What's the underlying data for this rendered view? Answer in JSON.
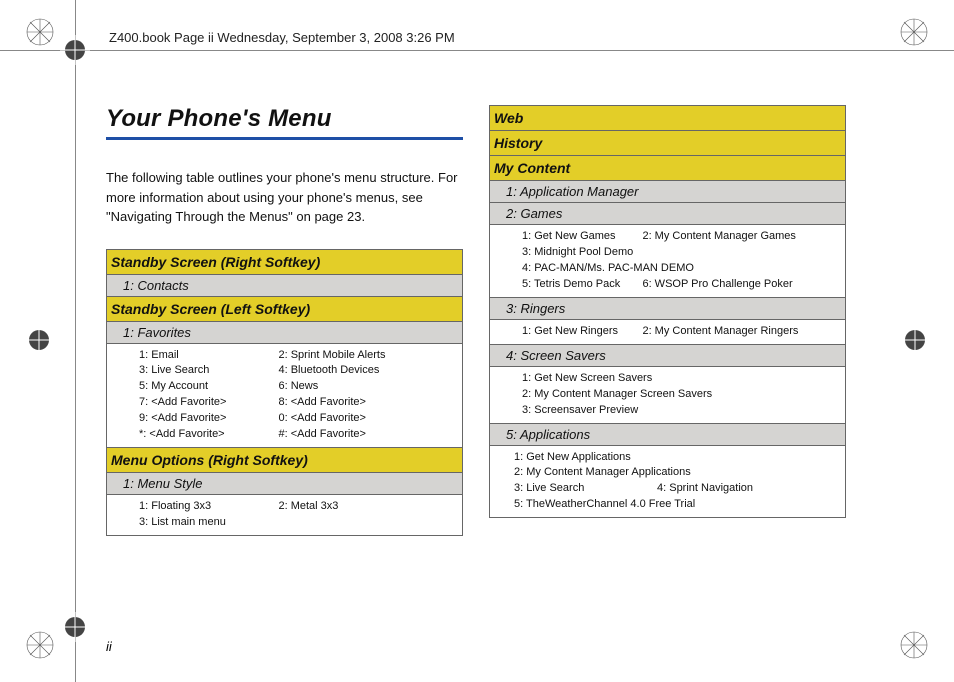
{
  "header": "Z400.book  Page ii  Wednesday, September 3, 2008  3:26 PM",
  "title": "Your Phone's Menu",
  "intro": "The following table outlines your phone's menu structure. For more information about using your phone's menus, see \"Navigating Through the Menus\" on page 23.",
  "page_number": "ii",
  "left_table": {
    "h1": "Standby Screen (Right Softkey)",
    "s1": "1: Contacts",
    "h2": "Standby Screen (Left Softkey)",
    "s2": "1: Favorites",
    "fav_l1": "1: Email",
    "fav_r1": "2: Sprint Mobile Alerts",
    "fav_l2": "3: Live Search",
    "fav_r2": "4: Bluetooth Devices",
    "fav_l3": "5: My Account",
    "fav_r3": "6: News",
    "fav_l4": "7: <Add Favorite>",
    "fav_r4": "8: <Add Favorite>",
    "fav_l5": "9: <Add Favorite>",
    "fav_r5": "0: <Add Favorite>",
    "fav_l6": "*: <Add Favorite>",
    "fav_r6": "#: <Add Favorite>",
    "h3": "Menu Options (Right Softkey)",
    "s3": "1: Menu Style",
    "ms_l1": "1: Floating 3x3",
    "ms_r1": "2: Metal 3x3",
    "ms_l2": "3: List main menu"
  },
  "right_table": {
    "h1": "Web",
    "h2": "History",
    "h3": "My Content",
    "s1": "1: Application Manager",
    "s2": "2: Games",
    "g_l1": "1: Get New Games",
    "g_r1": "2: My Content Manager Games",
    "g_l2": "3: Midnight Pool Demo",
    "g_l3": "4: PAC-MAN/Ms. PAC-MAN DEMO",
    "g_l4": "5: Tetris Demo Pack",
    "g_r4": "6: WSOP Pro Challenge Poker",
    "s3": "3: Ringers",
    "r_l1": "1: Get New Ringers",
    "r_r1": "2: My Content Manager Ringers",
    "s4": "4: Screen Savers",
    "ss_1": "1: Get New Screen Savers",
    "ss_2": "2: My Content Manager Screen Savers",
    "ss_3": "3: Screensaver Preview",
    "s5": "5: Applications",
    "a_1": "1: Get New Applications",
    "a_2": "2: My Content Manager Applications",
    "a_l3": "3: Live Search",
    "a_r3": "4: Sprint Navigation",
    "a_4": "5: TheWeatherChannel 4.0 Free Trial"
  }
}
